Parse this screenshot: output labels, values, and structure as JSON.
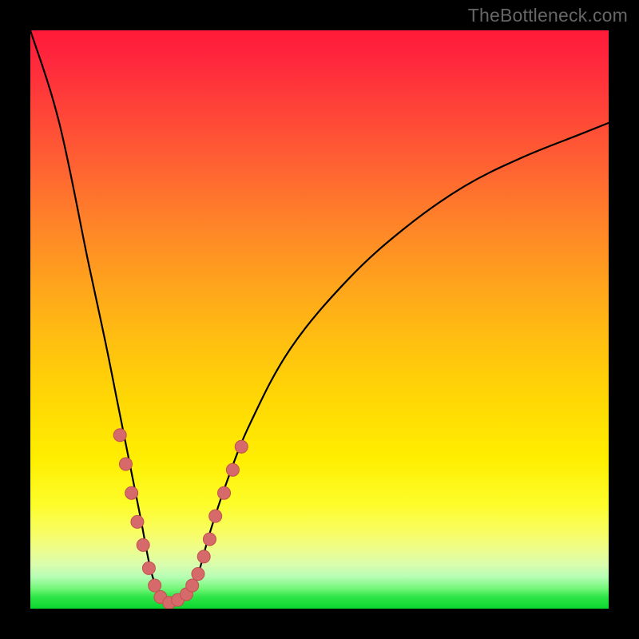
{
  "watermark": "TheBottleneck.com",
  "colors": {
    "frame_bg": "#000000",
    "watermark": "#666666",
    "curve_stroke": "#000000",
    "dot_fill": "#d66a6a",
    "dot_stroke": "#c24f4f",
    "gradient_top": "#ff1a3a",
    "gradient_bottom": "#0bd62f"
  },
  "chart_data": {
    "type": "line",
    "title": "",
    "xlabel": "",
    "ylabel": "",
    "xlim": [
      0,
      100
    ],
    "ylim": [
      0,
      100
    ],
    "grid": false,
    "legend": false,
    "notes": "V-shaped bottleneck curve. X is an unlabeled normalized axis (0–100 left→right). Y is an unlabeled normalized severity (0 at bottom = optimal/green, 100 at top = severe/red). Curve minimum (~0) sits near x≈24 with a flat basin roughly x∈[21,28]. Pink dots mark sampled points along the lower arms of the curve.",
    "series": [
      {
        "name": "bottleneck_curve",
        "x": [
          0,
          5,
          10,
          13,
          15,
          17,
          19,
          21,
          23,
          25,
          27,
          29,
          31,
          34,
          38,
          45,
          55,
          65,
          75,
          85,
          95,
          100
        ],
        "y": [
          100,
          84,
          60,
          46,
          36,
          26,
          16,
          6,
          2,
          1,
          2,
          6,
          13,
          22,
          32,
          45,
          57,
          66,
          73,
          78,
          82,
          84
        ]
      },
      {
        "name": "sample_dots",
        "x": [
          15.5,
          16.5,
          17.5,
          18.5,
          19.5,
          20.5,
          21.5,
          22.5,
          24.0,
          25.5,
          27.0,
          28.0,
          29.0,
          30.0,
          31.0,
          32.0,
          33.5,
          35.0,
          36.5
        ],
        "y": [
          30.0,
          25.0,
          20.0,
          15.0,
          11.0,
          7.0,
          4.0,
          2.0,
          1.0,
          1.5,
          2.5,
          4.0,
          6.0,
          9.0,
          12.0,
          16.0,
          20.0,
          24.0,
          28.0
        ]
      }
    ]
  }
}
